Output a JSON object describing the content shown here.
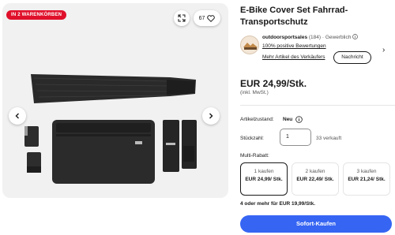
{
  "gallery": {
    "cart_badge": "IN 2 WARENKÖRBEN",
    "watch_count": "67",
    "icons": {
      "expand": "expand-icon",
      "watch": "heart-icon",
      "prev": "chevron-left-icon",
      "next": "chevron-right-icon"
    }
  },
  "product": {
    "title": "E-Bike Cover Set Fahrrad-Transportschutz"
  },
  "seller": {
    "name": "outdoorsportsales",
    "count": "(184)",
    "type": "· Gewerblich",
    "feedback": "100% positive Bewertungen",
    "more_items": "Mehr Artikel des Verkäufers",
    "contact_label": "Nachricht"
  },
  "pricing": {
    "price": "EUR 24,99/Stk.",
    "vat": "(inkl. MwSt.)"
  },
  "details": {
    "condition_label": "Artikelzustand:",
    "condition_value": "Neu",
    "quantity_label": "Stückzahl:",
    "quantity_value": "1",
    "sold": "33 verkauft"
  },
  "multi_buy": {
    "label": "Multi-Rabatt:",
    "tiers": [
      {
        "qty": "1 kaufen",
        "price": "EUR 24,99/ Stk.",
        "selected": true
      },
      {
        "qty": "2 kaufen",
        "price": "EUR 22,49/ Stk.",
        "selected": false
      },
      {
        "qty": "3 kaufen",
        "price": "EUR 21,24/ Stk.",
        "selected": false
      }
    ],
    "bulk_note": "4 oder mehr für EUR 19,99/Stk."
  },
  "actions": {
    "buy_now": "Sofort-Kaufen"
  },
  "colors": {
    "badge": "#e0102b",
    "primary_button": "#3665f3",
    "text": "#191919"
  }
}
